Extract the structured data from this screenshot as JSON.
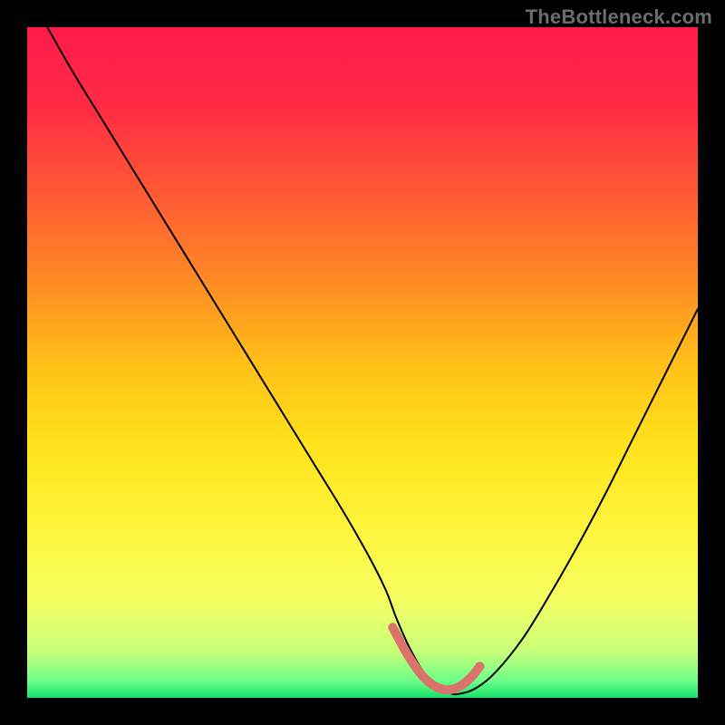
{
  "watermark": "TheBottleneck.com",
  "chart_data": {
    "type": "line",
    "title": "",
    "xlabel": "",
    "ylabel": "",
    "xlim": [
      0,
      100
    ],
    "ylim": [
      0,
      100
    ],
    "grid": false,
    "legend": false,
    "background": {
      "type": "vertical-gradient",
      "stops": [
        {
          "pos": 0.0,
          "color": "#ff1a4b"
        },
        {
          "pos": 0.12,
          "color": "#ff2b44"
        },
        {
          "pos": 0.25,
          "color": "#ff5a34"
        },
        {
          "pos": 0.38,
          "color": "#ff8b24"
        },
        {
          "pos": 0.5,
          "color": "#ffbf18"
        },
        {
          "pos": 0.62,
          "color": "#ffe21a"
        },
        {
          "pos": 0.74,
          "color": "#fff43a"
        },
        {
          "pos": 0.85,
          "color": "#f6ff60"
        },
        {
          "pos": 0.93,
          "color": "#c9ff7a"
        },
        {
          "pos": 0.975,
          "color": "#6cff88"
        },
        {
          "pos": 1.0,
          "color": "#16e06a"
        }
      ]
    },
    "series": [
      {
        "name": "bottleneck-curve",
        "stroke": "#000000",
        "stroke_width": 2,
        "x": [
          3,
          7,
          11,
          15,
          19,
          23,
          27,
          31,
          35,
          39,
          43,
          47,
          51,
          53.5,
          55,
          57,
          59,
          61,
          63,
          64.5,
          67,
          70,
          74,
          78,
          82,
          86,
          90,
          94,
          98,
          100
        ],
        "y": [
          100,
          93,
          86.5,
          80,
          73.5,
          67,
          60.5,
          54,
          47.5,
          41,
          34.5,
          28,
          21,
          16,
          12,
          7.5,
          4,
          1.8,
          0.7,
          0.6,
          1.5,
          4,
          9,
          15.5,
          22.5,
          30,
          38,
          46,
          54,
          58
        ]
      },
      {
        "name": "trough-highlight",
        "stroke": "#d9736b",
        "stroke_width": 10,
        "linecap": "round",
        "x": [
          54.5,
          55.5,
          56.5,
          57.5,
          58.5,
          59.5,
          60.5,
          61.5,
          62.5,
          63.5,
          64.5,
          65.5,
          66.5,
          67.5
        ],
        "y": [
          10.5,
          8.6,
          6.8,
          5.2,
          3.8,
          2.7,
          1.9,
          1.4,
          1.2,
          1.3,
          1.7,
          2.4,
          3.4,
          4.7
        ]
      }
    ]
  }
}
